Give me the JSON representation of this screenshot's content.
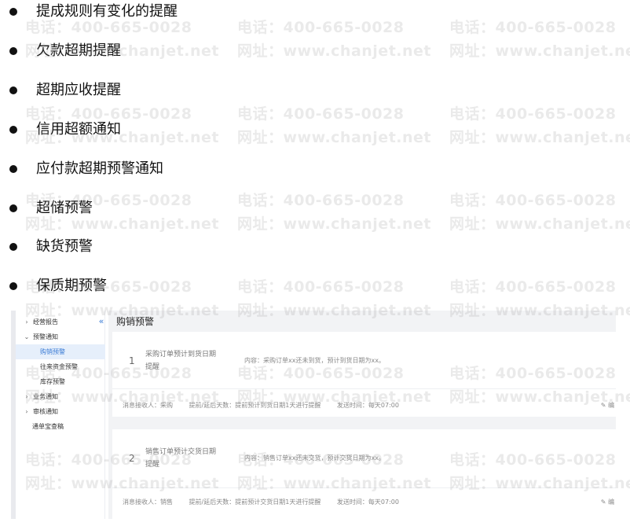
{
  "bullets": [
    "提成规则有变化的提醒",
    "欠款超期提醒",
    "超期应收提醒",
    "信用超额通知",
    "应付款超期预警通知",
    "超储预警",
    "缺货预警",
    "保质期预警"
  ],
  "screenshot": {
    "sidebar": {
      "items": [
        {
          "label": "经营报告",
          "chevron": "›"
        },
        {
          "label": "预警通知",
          "chevron": "⌄"
        },
        {
          "label": "购销预警"
        },
        {
          "label": "往来资金预警"
        },
        {
          "label": "库存预警"
        },
        {
          "label": "业务通知",
          "chevron": "›"
        },
        {
          "label": "审核通知",
          "chevron": "›"
        },
        {
          "label": "通单宝查稿"
        }
      ],
      "collapse_glyph": "«"
    },
    "main": {
      "title": "购销预警",
      "cards": [
        {
          "number": "1",
          "title": "采购订单预计到货日期提醒",
          "content": "内容：采购订单xx还未到货，预计到货日期为xx。",
          "receiver": "消息接收人：采购",
          "days": "提前/延后天数：提前预计到货日期1天进行提醒",
          "send_time": "发送时间：每天07:00",
          "edit": "✎ 编"
        },
        {
          "number": "2",
          "title": "销售订单预计交货日期提醒",
          "content": "内容：销售订单xx还未交货，预计交货日期为xx。",
          "receiver": "消息接收人：销售",
          "days": "提前/延后天数：提前预计交货日期1天进行提醒",
          "send_time": "发送时间：每天07:00",
          "edit": "✎ 编"
        }
      ]
    }
  },
  "watermark": {
    "phone": "电话：400-665-0028",
    "site": "网址：www.chanjet.net"
  }
}
